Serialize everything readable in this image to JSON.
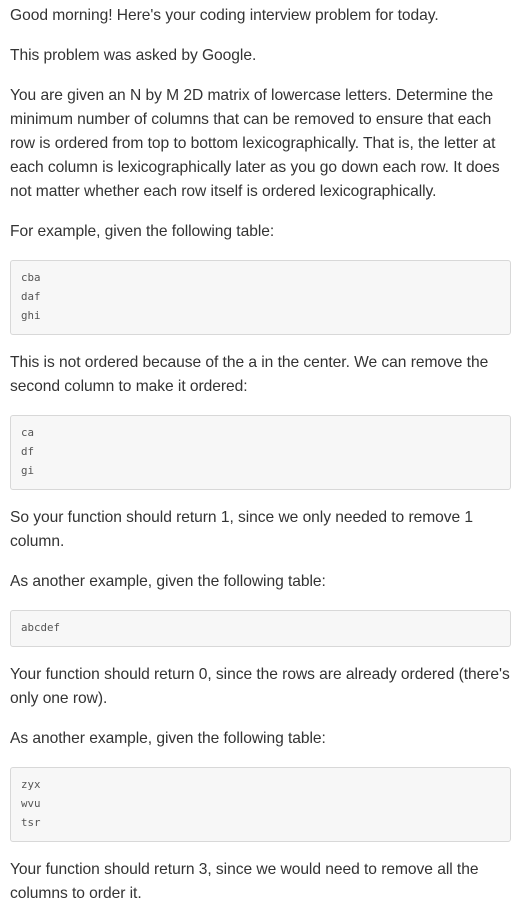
{
  "content": {
    "greeting": "Good morning! Here's your coding interview problem for today.",
    "asked_by": "This problem was asked by Google.",
    "problem": "You are given an N by M 2D matrix of lowercase letters. Determine the minimum number of columns that can be removed to ensure that each row is ordered from top to bottom lexicographically. That is, the letter at each column is lexicographically later as you go down each row. It does not matter whether each row itself is ordered lexicographically.",
    "example1_intro": "For example, given the following table:",
    "example1_table": [
      "cba",
      "daf",
      "ghi"
    ],
    "example1_explain": "This is not ordered because of the a in the center. We can remove the second column to make it ordered:",
    "example1_fixed": [
      "ca",
      "df",
      "gi"
    ],
    "example1_result": "So your function should return 1, since we only needed to remove 1 column.",
    "example2_intro": "As another example, given the following table:",
    "example2_table": [
      "abcdef"
    ],
    "example2_result": "Your function should return 0, since the rows are already ordered (there's only one row).",
    "example3_intro": "As another example, given the following table:",
    "example3_table": [
      "zyx",
      "wvu",
      "tsr"
    ],
    "example3_result": "Your function should return 3, since we would need to remove all the columns to order it."
  }
}
